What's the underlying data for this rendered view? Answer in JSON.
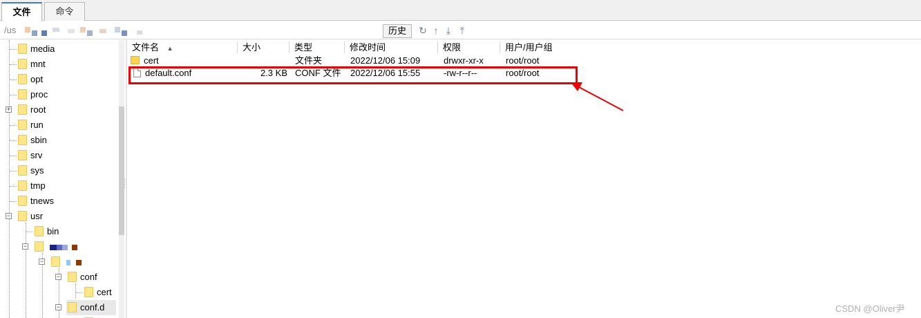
{
  "tabs": [
    {
      "label": "文件",
      "active": true
    },
    {
      "label": "命令",
      "active": false
    }
  ],
  "pathbar": {
    "path_prefix": "/us",
    "history_label": "历史",
    "icons": [
      "refresh-icon",
      "up-dir-icon",
      "download-icon",
      "upload-icon"
    ]
  },
  "tree": {
    "items": [
      {
        "label": "media"
      },
      {
        "label": "mnt"
      },
      {
        "label": "opt"
      },
      {
        "label": "proc"
      },
      {
        "label": "root"
      },
      {
        "label": "run"
      },
      {
        "label": "sbin"
      },
      {
        "label": "srv"
      },
      {
        "label": "sys"
      },
      {
        "label": "tmp"
      },
      {
        "label": "tnews"
      },
      {
        "label": "usr"
      },
      {
        "label": "bin"
      },
      {
        "label": ""
      },
      {
        "label": ""
      },
      {
        "label": "conf"
      },
      {
        "label": "cert"
      },
      {
        "label": "conf.d"
      }
    ]
  },
  "filelist": {
    "columns": [
      "文件名",
      "大小",
      "类型",
      "修改时间",
      "权限",
      "用户/用户组"
    ],
    "rows": [
      {
        "name": "cert",
        "size": "",
        "type": "文件夹",
        "modified": "2022/12/06 15:09",
        "perms": "drwxr-xr-x",
        "owner": "root/root",
        "kind": "folder"
      },
      {
        "name": "default.conf",
        "size": "2.3 KB",
        "type": "CONF 文件",
        "modified": "2022/12/06 15:55",
        "perms": "-rw-r--r--",
        "owner": "root/root",
        "kind": "file"
      }
    ]
  },
  "colors": {
    "highlight": "#ee0000",
    "folder": "#fde68a"
  },
  "watermark": "CSDN @Oliver尹"
}
